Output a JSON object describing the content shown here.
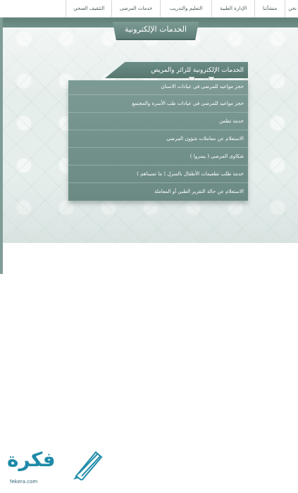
{
  "nav": {
    "items": [
      {
        "label": "نحن"
      },
      {
        "label": "منشآتنا"
      },
      {
        "label": "الإدارة الطبية"
      },
      {
        "label": "التعليم والتدريب"
      },
      {
        "label": "خدمات المرضى"
      },
      {
        "label": "التثقيف الصحي"
      }
    ]
  },
  "page": {
    "title": "الخدمات الإلكترونية"
  },
  "services": {
    "heading": "الخدمات الإلكترونية للزائر والمريض",
    "items": [
      {
        "label": "حجز مواعيد للمرضى في عيادات الاسنان"
      },
      {
        "label": "حجز مواعيد للمرضى في عيادات طب الأسرة والمجتمع"
      },
      {
        "label": "خدمة تطمن"
      },
      {
        "label": "الاستعلام عن معاملات شؤون المرضى"
      },
      {
        "label": "شكاوى المرضى ( يسروا )"
      },
      {
        "label": "خدمة طلب تطعيمات الأطفال بالمنزل ( ما تسيناهم )"
      },
      {
        "label": "الاستعلام عن حالة التقرير الطبي أو المعاملة"
      }
    ]
  },
  "logo": {
    "text": "فكرة",
    "url": "fekera.com",
    "icon": "pencil-icon",
    "color": "#1f8aa8"
  },
  "colors": {
    "accent": "#6c8d87",
    "banner": "#5d7d76",
    "panel": "#7d9a95"
  }
}
